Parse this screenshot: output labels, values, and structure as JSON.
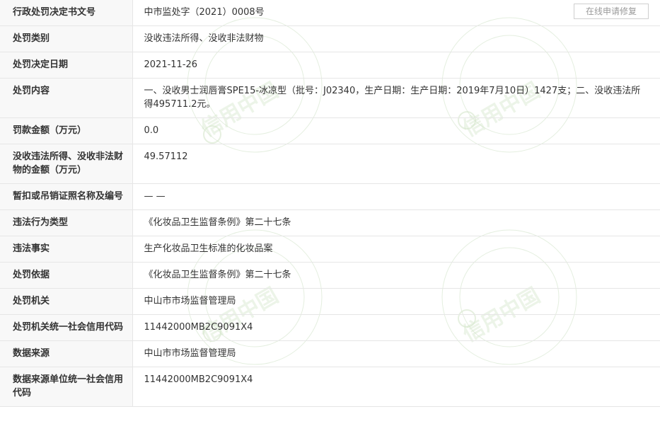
{
  "repair_button_label": "在线申请修复",
  "rows": [
    {
      "label": "行政处罚决定书文号",
      "value": "中市监处字（2021）0008号"
    },
    {
      "label": "处罚类别",
      "value": "没收违法所得、没收非法财物"
    },
    {
      "label": "处罚决定日期",
      "value": "2021-11-26"
    },
    {
      "label": "处罚内容",
      "value": "一、没收男士润唇膏SPE15-冰凉型（批号：J02340，生产日期：生产日期：2019年7月10日）1427支；二、没收违法所得495711.2元。"
    },
    {
      "label": "罚款金额（万元）",
      "value": "0.0"
    },
    {
      "label": "没收违法所得、没收非法财物的金额（万元）",
      "value": "49.57112"
    },
    {
      "label": "暂扣或吊销证照名称及编号",
      "value": "— —"
    },
    {
      "label": "违法行为类型",
      "value": "《化妆品卫生监督条例》第二十七条"
    },
    {
      "label": "违法事实",
      "value": "生产化妆品卫生标准的化妆品案"
    },
    {
      "label": "处罚依据",
      "value": "《化妆品卫生监督条例》第二十七条"
    },
    {
      "label": "处罚机关",
      "value": "中山市市场监督管理局"
    },
    {
      "label": "处罚机关统一社会信用代码",
      "value": "11442000MB2C9091X4"
    },
    {
      "label": "数据来源",
      "value": "中山市市场监督管理局"
    },
    {
      "label": "数据来源单位统一社会信用代码",
      "value": "11442000MB2C9091X4"
    }
  ],
  "watermark_text": "信用中国"
}
